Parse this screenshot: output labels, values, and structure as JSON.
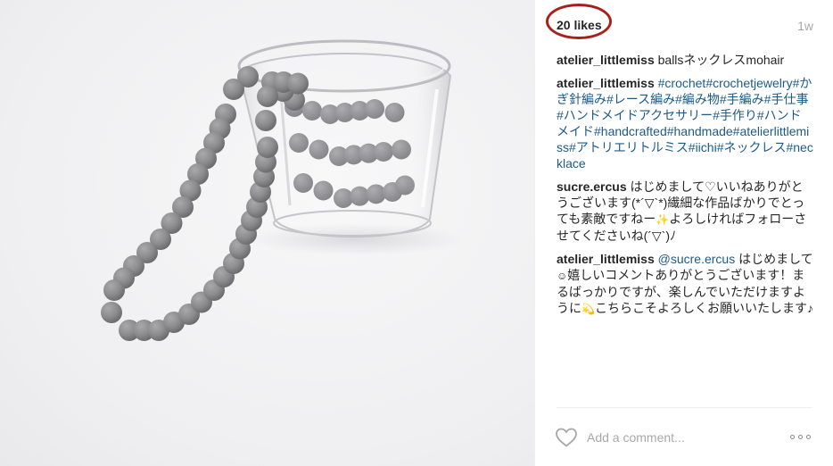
{
  "post": {
    "likes_text": "20 likes",
    "time_ago": "1w",
    "caption": {
      "username": "atelier_littlemiss",
      "text": " ballsネックレスmohair"
    },
    "tags_comment": {
      "username": "atelier_littlemiss",
      "tags": " #crochet#crochetjewelry#かぎ針編み#レース編み#編み物#手編み#手仕事#ハンドメイドアクセサリー#手作り#ハンドメイド#handcrafted#handmade#atelierlittlemiss#アトリエリトルミス#iichi#ネックレス#necklace"
    },
    "comment_1": {
      "username": "sucre.ercus",
      "text_a": " はじめまして♡いいねありがとうございます(*´▽`*)繊細な作品ばかりでとっても素敵ですねー",
      "emoji": "✨",
      "text_b": "よろしければフォローさせてくださいね(´▽`)ﾉ"
    },
    "comment_2": {
      "username": "atelier_littlemiss",
      "mention": " @sucre.ercus",
      "text_a": " はじめまして",
      "emoji_a": "☺",
      "text_b": "嬉しいコメントありがとうございます！まるばっかりですが、楽しんでいただけますように",
      "emoji_b": "💫",
      "text_c": "こちらこそよろしくお願いいたします♪"
    },
    "add_comment_placeholder": "Add a comment...",
    "icons": {
      "like": "heart-outline-icon",
      "more": "more-options-icon"
    },
    "colors": {
      "highlight_ring": "#a8201a",
      "link": "#1e5b86",
      "muted": "#a8a8a8"
    }
  }
}
